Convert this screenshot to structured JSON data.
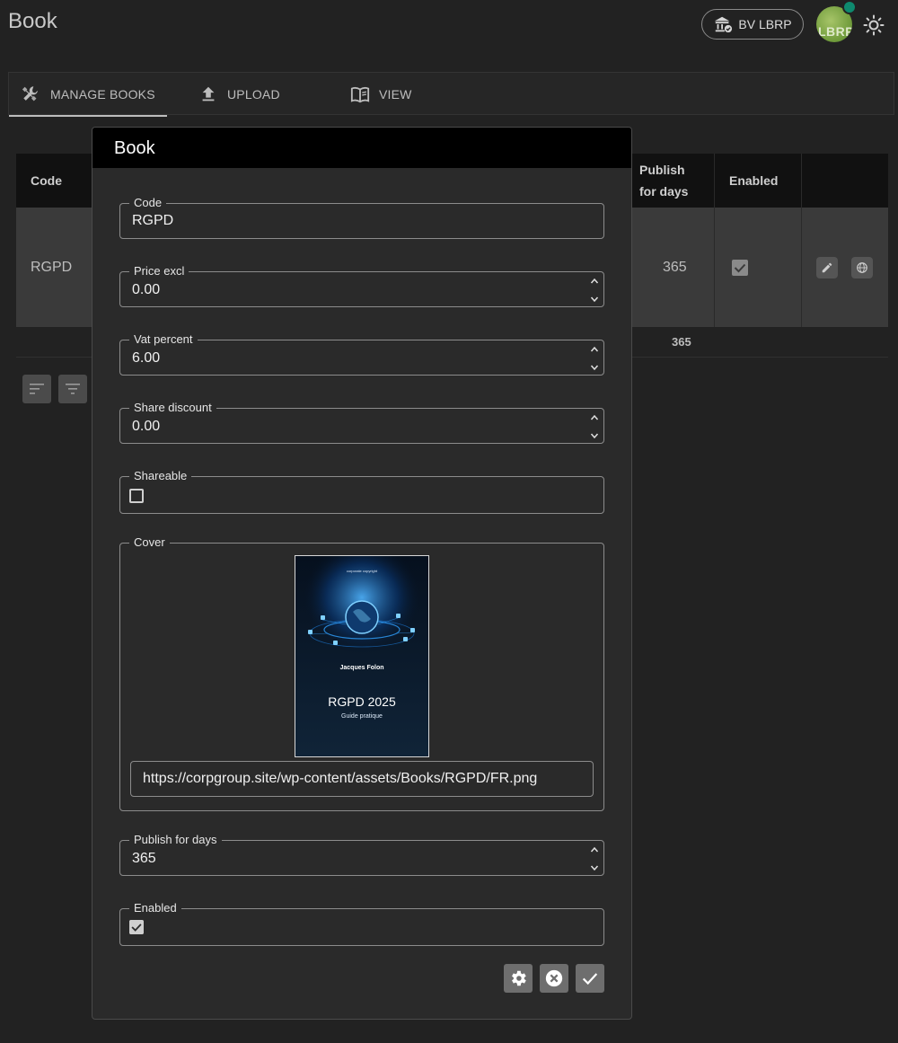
{
  "app": {
    "title": "Book"
  },
  "header": {
    "org_label": "BV LBRP",
    "avatar_text": "LBRP"
  },
  "tabs": [
    {
      "label": "MANAGE BOOKS",
      "icon": "tools-icon",
      "active": true
    },
    {
      "label": "UPLOAD",
      "icon": "upload-icon",
      "active": false
    },
    {
      "label": "VIEW",
      "icon": "book-open-icon",
      "active": false
    }
  ],
  "table": {
    "headers": {
      "code": "Code",
      "publish_l1": "Publish",
      "publish_l2": "for days",
      "enabled": "Enabled"
    },
    "row": {
      "code": "RGPD",
      "publish_days": "365",
      "enabled": true
    },
    "footer_total": "365"
  },
  "dialog": {
    "title": "Book",
    "code": {
      "label": "Code",
      "value": "RGPD"
    },
    "price": {
      "label": "Price excl",
      "value": "0.00"
    },
    "vat": {
      "label": "Vat percent",
      "value": "6.00"
    },
    "share_discount": {
      "label": "Share discount",
      "value": "0.00"
    },
    "shareable": {
      "label": "Shareable",
      "checked": false
    },
    "cover": {
      "label": "Cover",
      "url": "https://corpgroup.site/wp-content/assets/Books/RGPD/FR.png",
      "image_top_text": "corporate copyright",
      "image_author": "Jacques Folon",
      "image_title": "RGPD 2025",
      "image_subtitle": "Guide pratique"
    },
    "publish_days": {
      "label": "Publish for days",
      "value": "365"
    },
    "enabled": {
      "label": "Enabled",
      "checked": true
    }
  },
  "colors": {
    "background": "#222222",
    "dialog": "#2a2a2a",
    "header": "#000000",
    "status": "#0e8a6e"
  }
}
